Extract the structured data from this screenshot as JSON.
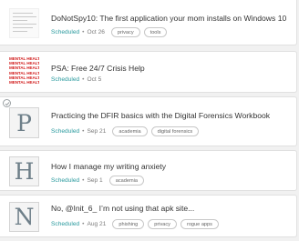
{
  "posts": [
    {
      "title": "DoNotSpy10: The first application your mom installs on Windows 10",
      "status": "Scheduled",
      "separator": "•",
      "date": "Oct 26",
      "tags": [
        "privacy",
        "tools"
      ],
      "thumbnail": "document-preview"
    },
    {
      "title": "PSA: Free 24/7 Crisis Help",
      "status": "Scheduled",
      "separator": "•",
      "date": "Oct 5",
      "tags": [],
      "thumbnail": "mental-health-pattern",
      "thumbnail_text": "MENTAL HEALTH MATTERS"
    },
    {
      "title": "Practicing the DFIR basics with the Digital Forensics Workbook",
      "status": "Scheduled",
      "separator": "•",
      "date": "Sep 21",
      "tags": [
        "academia",
        "digital forensics"
      ],
      "thumbnail": "letter-placeholder",
      "initial": "P"
    },
    {
      "title": "How I manage my writing anxiety",
      "status": "Scheduled",
      "separator": "•",
      "date": "Sep 1",
      "tags": [
        "academia"
      ],
      "thumbnail": "letter-placeholder",
      "initial": "H"
    },
    {
      "title": "No, @Init_6_ I’m not using that apk site...",
      "status": "Scheduled",
      "separator": "•",
      "date": "Aug 21",
      "tags": [
        "phishing",
        "privacy",
        "rogue apps"
      ],
      "thumbnail": "letter-placeholder",
      "initial": "N"
    }
  ],
  "colors": {
    "status": "#2a9a9e",
    "background": "#f1f1f1",
    "card": "#ffffff",
    "placeholder_letter": "#6e7f89",
    "thumbnail_text": "#d21f1f"
  },
  "icons": {
    "selection_badge": "check-circle-icon"
  }
}
